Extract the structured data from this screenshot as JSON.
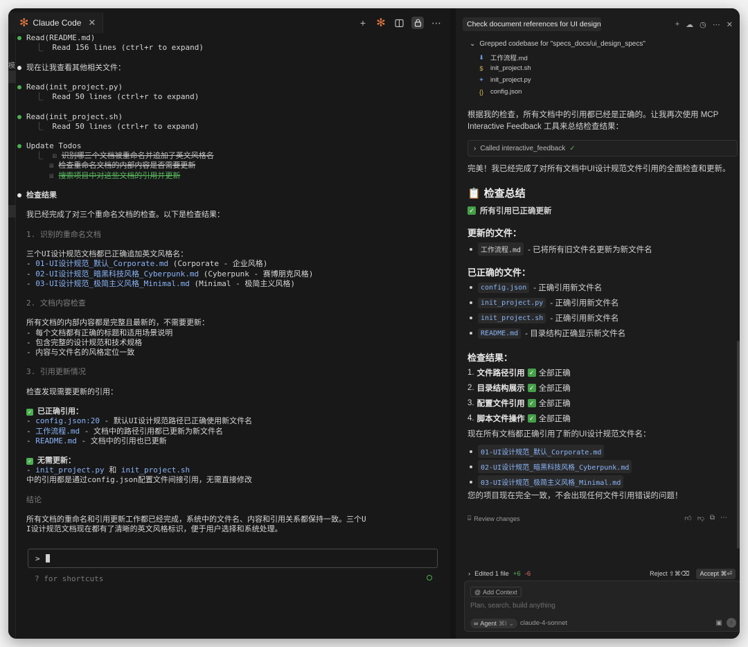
{
  "left": {
    "tab_title": "Claude Code",
    "gutter_text": "模",
    "terminal_lines": [
      {
        "dot": "green",
        "text": "Read(README.md)"
      },
      {
        "indent": "  ⎿  ",
        "text": "Read 156 lines (ctrl+r to expand)"
      },
      {
        "text": ""
      },
      {
        "dot": "white",
        "text": "现在让我查看其他相关文件："
      },
      {
        "text": ""
      },
      {
        "dot": "green",
        "text": "Read(init_project.py)"
      },
      {
        "indent": "  ⎿  ",
        "text": "Read 50 lines (ctrl+r to expand)"
      },
      {
        "text": ""
      },
      {
        "dot": "green",
        "text": "Read(init_project.sh)"
      },
      {
        "indent": "  ⎿  ",
        "text": "Read 50 lines (ctrl+r to expand)"
      },
      {
        "text": ""
      },
      {
        "dot": "green",
        "text": "Update Todos"
      },
      {
        "indent": "  ⎿  ☒ ",
        "style": "strike",
        "text": "识别哪三个文档被重命名并追加了英文风格名"
      },
      {
        "indent": "     ☒ ",
        "style": "strike",
        "text": "检查重命名文档的内部内容是否需要更新"
      },
      {
        "indent": "     ☒ ",
        "style": "strike-green",
        "text": "搜索项目中对这些文档的引用并更新"
      },
      {
        "text": ""
      },
      {
        "dot": "white",
        "style": "bold",
        "text": "检查结果"
      },
      {
        "text": ""
      },
      {
        "text": "我已经完成了对三个重命名文档的检查。以下是检查结果："
      },
      {
        "text": ""
      },
      {
        "style": "dim",
        "text": "1. 识别的重命名文档"
      },
      {
        "text": ""
      },
      {
        "text": "三个UI设计规范文档都已正确追加英文风格名："
      },
      {
        "prefix": "- ",
        "code": "01-UI设计规范_默认_Corporate.md",
        "text": " (Corporate - 企业风格)"
      },
      {
        "prefix": "- ",
        "code": "02-UI设计规范_暗黑科技风格_Cyberpunk.md",
        "text": " (Cyberpunk - 赛博朋克风格)"
      },
      {
        "prefix": "- ",
        "code": "03-UI设计规范_极简主义风格_Minimal.md",
        "text": " (Minimal - 极简主义风格)"
      },
      {
        "text": ""
      },
      {
        "style": "dim",
        "text": "2. 文档内容检查"
      },
      {
        "text": ""
      },
      {
        "text": "所有文档的内部内容都是完整且最新的，不需要更新："
      },
      {
        "text": "- 每个文档都有正确的标题和适用场景说明"
      },
      {
        "text": "- 包含完整的设计规范和技术规格"
      },
      {
        "text": "- 内容与文件名的风格定位一致"
      },
      {
        "text": ""
      },
      {
        "style": "dim",
        "text": "3. 引用更新情况"
      },
      {
        "text": ""
      },
      {
        "text": "检查发现需要更新的引用："
      },
      {
        "text": ""
      },
      {
        "check": true,
        "style": "bold",
        "text": "已正确引用："
      },
      {
        "prefix": "- ",
        "code": "config.json:20",
        "text": " - 默认UI设计规范路径已正确使用新文件名"
      },
      {
        "prefix": "- ",
        "code": "工作流程.md",
        "text": " - 文档中的路径引用都已更新为新文件名"
      },
      {
        "prefix": "- ",
        "code": "README.md",
        "text": " - 文档中的引用也已更新"
      },
      {
        "text": ""
      },
      {
        "check": true,
        "style": "bold",
        "text": "无需更新："
      },
      {
        "prefix": "- ",
        "code": "init_project.py",
        "mid": " 和 ",
        "code2": "init_project.sh",
        "text": ""
      },
      {
        "text": "中的引用都是通过config.json配置文件间接引用，无需直接修改"
      },
      {
        "text": ""
      },
      {
        "style": "dim",
        "text": "结论"
      },
      {
        "text": ""
      },
      {
        "text": "所有文档的重命名和引用更新工作都已经完成，系统中的文件名、内容和引用关系都保持一致。三个U"
      },
      {
        "text": "I设计规范文档现在都有了清晰的英文风格标识，便于用户选择和系统处理。"
      }
    ],
    "prompt_symbol": ">",
    "shortcut_hint": "? for shortcuts"
  },
  "right": {
    "tab_title": "Check document references for UI design s",
    "grep_header": "Grepped codebase for \"specs_docs/ui_design_specs\"",
    "files": [
      {
        "icon": "⬇",
        "color": "#6fa0e8",
        "name": "工作流程.md"
      },
      {
        "icon": "$",
        "color": "#c9b458",
        "name": "init_project.sh"
      },
      {
        "icon": "✦",
        "color": "#5c8fd6",
        "name": "init_project.py"
      },
      {
        "icon": "{}",
        "color": "#d8b84e",
        "name": "config.json"
      }
    ],
    "para1": "根据我的检查，所有文档中的引用都已经是正确的。让我再次使用 MCP Interactive Feedback 工具来总结检查结果：",
    "called_label": "Called interactive_feedback",
    "para2": "完美！我已经完成了对所有文档中UI设计规范文件引用的全面检查和更新。",
    "summary_title": "检查总结",
    "summary_status": "所有引用已正确更新",
    "updated_title": "更新的文件：",
    "updated_items": [
      {
        "code": "工作流程.md",
        "desc": " - 已将所有旧文件名更新为新文件名"
      }
    ],
    "correct_title": "已正确的文件：",
    "correct_items": [
      {
        "code": "config.json",
        "desc": " - 正确引用新文件名"
      },
      {
        "code": "init_project.py",
        "desc": " - 正确引用新文件名"
      },
      {
        "code": "init_project.sh",
        "desc": " - 正确引用新文件名"
      },
      {
        "code": "README.md",
        "desc": " - 目录结构正确显示新文件名"
      }
    ],
    "results_title": "检查结果：",
    "results_items": [
      {
        "num": "1.",
        "label": "文件路径引用",
        "status": "全部正确"
      },
      {
        "num": "2.",
        "label": "目录结构展示",
        "status": "全部正确"
      },
      {
        "num": "3.",
        "label": "配置文件引用",
        "status": "全部正确"
      },
      {
        "num": "4.",
        "label": "脚本文件操作",
        "status": "全部正确"
      }
    ],
    "para3": "现在所有文档都正确引用了新的UI设计规范文件名：",
    "file_links": [
      "01-UI设计规范_默认_Corporate.md",
      "02-UI设计规范_暗黑科技风格_Cyberpunk.md",
      "03-UI设计规范_极简主义风格_Minimal.md"
    ],
    "para4": "您的项目现在完全一致，不会出现任何文件引用错误的问题！",
    "review_label": "Review changes",
    "edited_label": "Edited 1 file",
    "edited_plus": "+6",
    "edited_minus": "-6",
    "reject_label": "Reject ⇧⌘⌫",
    "accept_label": "Accept ⌘⏎",
    "add_context": "Add Context",
    "composer_placeholder": "Plan, search, build anything",
    "agent_label": "Agent",
    "agent_shortcut": "⌘I",
    "model_name": "claude-4-sonnet"
  },
  "colors": {
    "accent_green": "#4caf50",
    "link_blue": "#8ab4f8",
    "claude_orange": "#e8793f"
  }
}
